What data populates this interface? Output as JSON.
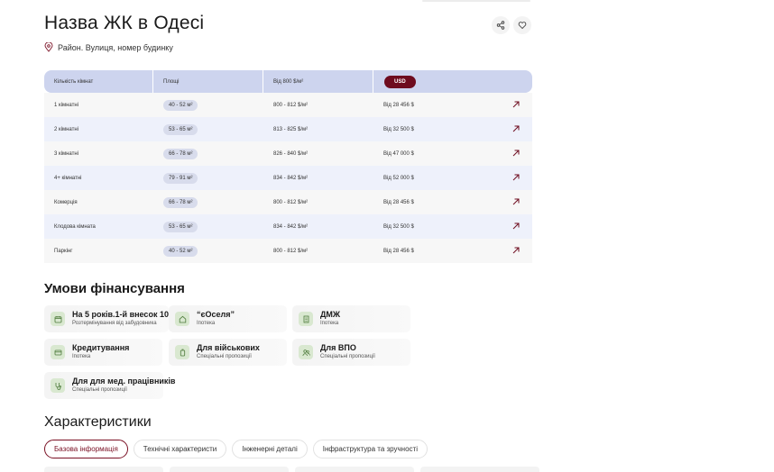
{
  "header": {
    "title": "Назва ЖК в Одесі",
    "address": "Район. Вулиця, номер будинку"
  },
  "table": {
    "headers": {
      "rooms": "Кількість кімнат",
      "area": "Площі",
      "price_from": "Від 800 $/м²",
      "currency": "USD"
    },
    "rows": [
      {
        "rooms": "1 кімнатні",
        "area": "40 - 52 м²",
        "ppm": "800 - 812 $/м²",
        "price": "Від 28 456 $"
      },
      {
        "rooms": "2 кімнатні",
        "area": "53 - 65 м²",
        "ppm": "813 - 825 $/м²",
        "price": "Від 32 500 $"
      },
      {
        "rooms": "3  кімнатні",
        "area": "66 - 78 м²",
        "ppm": "826 - 840 $/м²",
        "price": "Від 47 000 $"
      },
      {
        "rooms": "4+ кімнатні",
        "area": "79 - 91 м²",
        "ppm": "834 - 842 $/м²",
        "price": "Від 52 000 $"
      },
      {
        "rooms": "Комерція",
        "area": "66 - 78 м²",
        "ppm": "800 - 812 $/м²",
        "price": "Від 28 456 $"
      },
      {
        "rooms": "Клодова кімната",
        "area": "53 - 65 м²",
        "ppm": "834 - 842 $/м²",
        "price": "Від 32 500 $"
      },
      {
        "rooms": "Паркінг",
        "area": "40 - 52 м²",
        "ppm": "800 - 812 $/м²",
        "price": "Від 28 456 $"
      }
    ]
  },
  "financing": {
    "title": "Умови фінансування",
    "cards": [
      {
        "title": "На 5 років.1-й внесок 10%",
        "subtitle": "Розтермінування від забудовника",
        "icon": "calendar-icon"
      },
      {
        "title": "“єОселя”",
        "subtitle": "Іпотека",
        "icon": "home-icon"
      },
      {
        "title": "ДМЖ",
        "subtitle": "Іпотека",
        "icon": "building-icon"
      },
      {
        "title": "Кредитування",
        "subtitle": "Іпотека",
        "icon": "credit-card-icon"
      },
      {
        "title": "Для військових",
        "subtitle": "Спеціальні пропозиції",
        "icon": "badge-icon"
      },
      {
        "title": "Для ВПО",
        "subtitle": "Спеціальні пропозиції",
        "icon": "people-icon"
      },
      {
        "title": "Для для мед. працівників",
        "subtitle": "Спеціальні пропозиції",
        "icon": "stethoscope-icon"
      }
    ]
  },
  "characteristics": {
    "title": "Характеристики",
    "tabs": [
      "Базова інформація",
      "Технічні характеристи",
      "Інженерні деталі",
      "Інфраструктура та зручності"
    ]
  },
  "colors": {
    "accent": "#6e0c1f",
    "table_header": "#cdd4ee",
    "row_alt": "#eef1fb",
    "icon_bg": "#d9e8d0"
  }
}
